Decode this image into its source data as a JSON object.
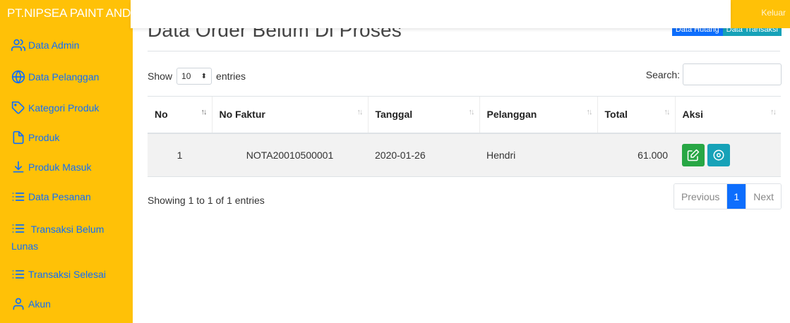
{
  "app": {
    "brand": "PT.NIPSEA PAINT AND C",
    "logout_label": "Keluar"
  },
  "sidebar": {
    "items": [
      {
        "label": "Data Admin",
        "icon": "users-icon"
      },
      {
        "label": "Data Pelanggan",
        "icon": "globe-icon"
      },
      {
        "label": "Kategori Produk",
        "icon": "tag-icon"
      },
      {
        "label": "Produk",
        "icon": "file-icon"
      },
      {
        "label": "Produk Masuk",
        "icon": "download-icon"
      },
      {
        "label": "Data Pesanan",
        "icon": "list-icon"
      },
      {
        "label": "Transaksi Belum Lunas",
        "icon": "list-icon"
      },
      {
        "label": "Transaksi Selesai",
        "icon": "list-icon"
      },
      {
        "label": "Akun",
        "icon": "user-icon"
      }
    ]
  },
  "main": {
    "title": "Data Order Belum Di Proses",
    "btn_hutang": "Data Hutang",
    "btn_transaksi": "Data Transaksi",
    "show_label": "Show",
    "entries_value": "10",
    "entries_label": "entries",
    "search_label": "Search:",
    "table": {
      "headers": [
        "No",
        "No Faktur",
        "Tanggal",
        "Pelanggan",
        "Total",
        "Aksi"
      ],
      "rows": [
        {
          "no": "1",
          "faktur": "NOTA20010500001",
          "tanggal": "2020-01-26",
          "pelanggan": "Hendri",
          "total": "61.000"
        }
      ]
    },
    "info": "Showing 1 to 1 of 1 entries",
    "pagination": {
      "prev": "Previous",
      "current": "1",
      "next": "Next"
    }
  },
  "colors": {
    "sidebar": "#ffc107",
    "link": "#0d6efd",
    "edit": "#28a745",
    "view": "#17a2b8"
  }
}
